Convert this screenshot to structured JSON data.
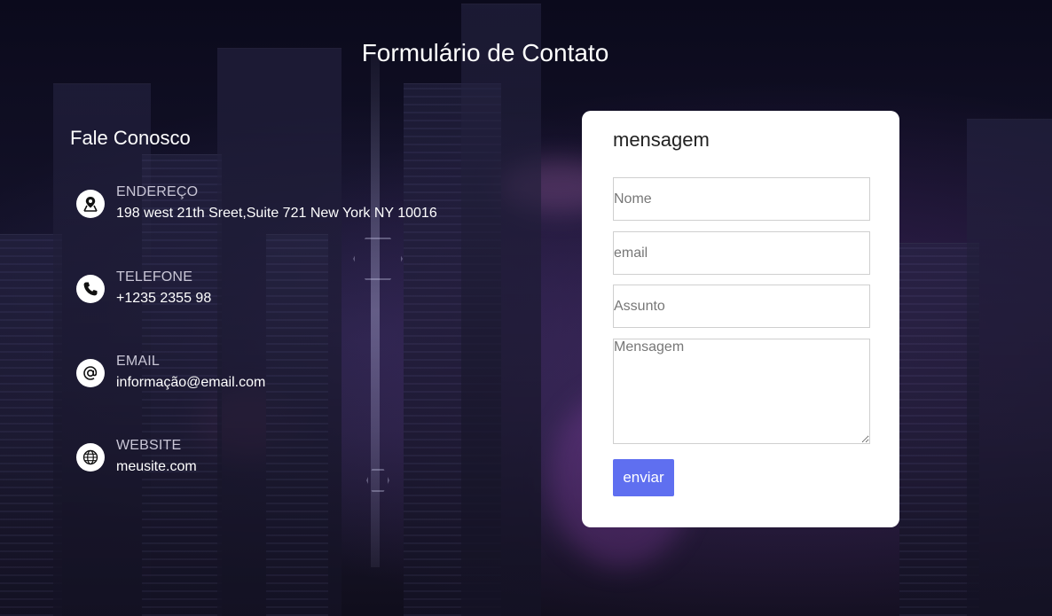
{
  "page": {
    "title": "Formulário de Contato"
  },
  "contact_info": {
    "heading": "Fale Conosco",
    "items": [
      {
        "icon": "map-pin-icon",
        "label": "ENDEREÇO",
        "value": "198 west 21th Sreet,Suite 721 New York NY 10016"
      },
      {
        "icon": "phone-icon",
        "label": "TELEFONE",
        "value": "+1235 2355 98"
      },
      {
        "icon": "at-sign-icon",
        "label": "EMAIL",
        "value": "informação@email.com"
      },
      {
        "icon": "globe-icon",
        "label": "WEBSITE",
        "value": "meusite.com"
      }
    ]
  },
  "form": {
    "heading": "mensagem",
    "name_placeholder": "Nome",
    "name_value": "",
    "email_placeholder": "email",
    "email_value": "",
    "subject_placeholder": "Assunto",
    "subject_value": "",
    "message_placeholder": "Mensagem",
    "message_value": "",
    "submit_label": "enviar"
  },
  "colors": {
    "accent": "#5f6ff0",
    "card_background": "#ffffff",
    "page_background": "#0d0b1c"
  }
}
